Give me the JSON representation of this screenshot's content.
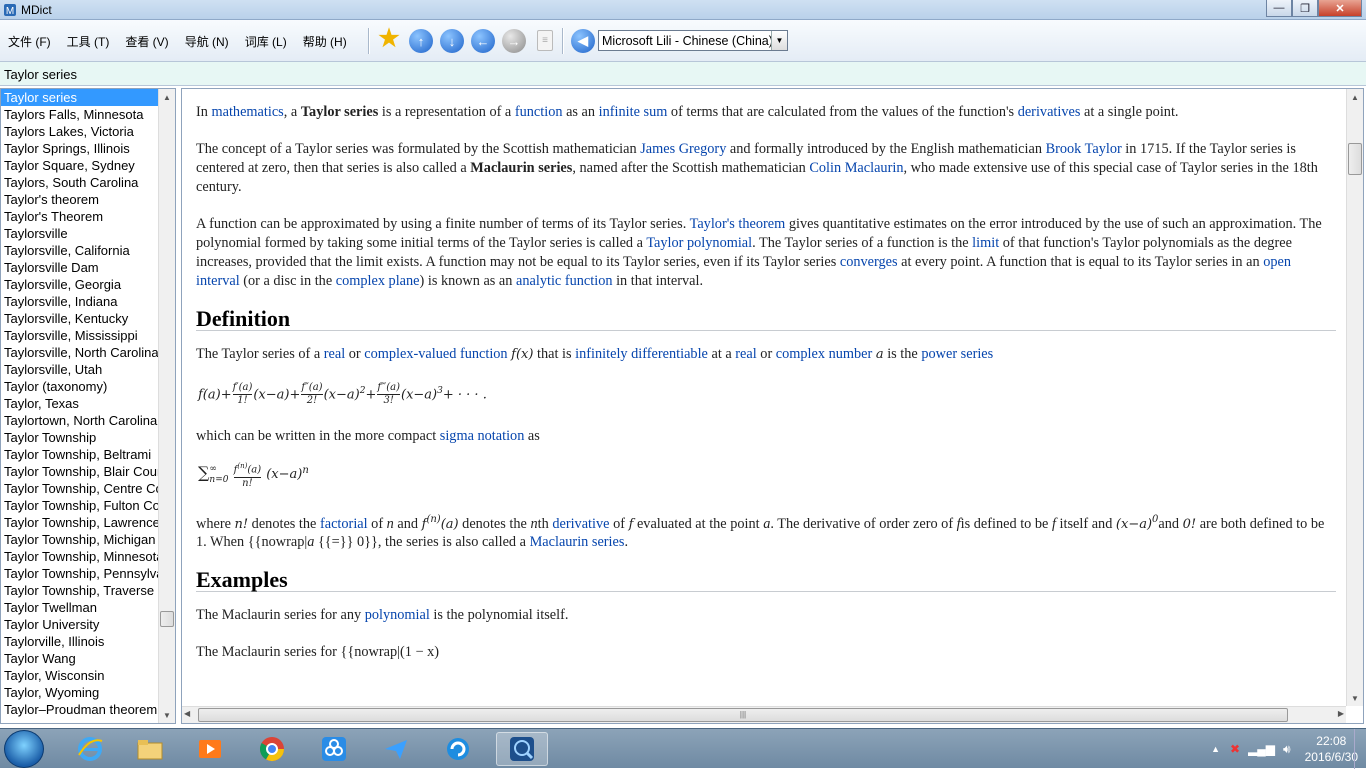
{
  "window": {
    "title": "MDict",
    "minimize": "—",
    "maximize": "❐",
    "close": "✕"
  },
  "menu": [
    "文件 (F)",
    "工具 (T)",
    "查看 (V)",
    "导航 (N)",
    "词库 (L)",
    "帮助 (H)"
  ],
  "toolbar": {
    "icons": [
      "star-icon",
      "arrow-up-icon",
      "arrow-down-icon",
      "back-icon",
      "forward-icon",
      "document-icon",
      "speak-icon"
    ],
    "voice_selected": "Microsoft Lili - Chinese (China)"
  },
  "search": {
    "value": "Taylor series"
  },
  "wordlist": [
    "Taylor series",
    "Taylors Falls, Minnesota",
    "Taylors Lakes, Victoria",
    "Taylor Springs, Illinois",
    "Taylor Square, Sydney",
    "Taylors, South Carolina",
    "Taylor's theorem",
    "Taylor's Theorem",
    "Taylorsville",
    "Taylorsville, California",
    "Taylorsville Dam",
    "Taylorsville, Georgia",
    "Taylorsville, Indiana",
    "Taylorsville, Kentucky",
    "Taylorsville, Mississippi",
    "Taylorsville, North Carolina",
    "Taylorsville, Utah",
    "Taylor (taxonomy)",
    "Taylor, Texas",
    "Taylortown, North Carolina",
    "Taylor Township",
    "Taylor Township, Beltrami",
    "Taylor Township, Blair County",
    "Taylor Township, Centre County",
    "Taylor Township, Fulton County",
    "Taylor Township, Lawrence",
    "Taylor Township, Michigan",
    "Taylor Township, Minnesota",
    "Taylor Township, Pennsylvania",
    "Taylor Township, Traverse",
    "Taylor Twellman",
    "Taylor University",
    "Taylorville, Illinois",
    "Taylor Wang",
    "Taylor, Wisconsin",
    "Taylor, Wyoming",
    "Taylor–Proudman theorem"
  ],
  "article": {
    "p1": {
      "t1": "In ",
      "l1": "mathematics",
      "t2": ", a ",
      "b1": "Taylor series",
      "t3": " is a representation of a ",
      "l2": "function",
      "t4": " as an ",
      "l3": "infinite sum",
      "t5": " of terms that are calculated from the values of the function's ",
      "l4": "derivatives",
      "t6": " at a single point."
    },
    "p2": {
      "t1": "The concept of a Taylor series was formulated by the Scottish mathematician ",
      "l1": "James Gregory",
      "t2": " and formally introduced by the English mathematician ",
      "l2": "Brook Taylor",
      "t3": " in 1715. If the Taylor series is centered at zero, then that series is also called a ",
      "b1": "Maclaurin series",
      "t4": ", named after the Scottish mathematician ",
      "l3": "Colin Maclaurin",
      "t5": ", who made extensive use of this special case of Taylor series in the 18th century."
    },
    "p3": {
      "t1": "A function can be approximated by using a finite number of terms of its Taylor series. ",
      "l1": "Taylor's theorem",
      "t2": " gives quantitative estimates on the error introduced by the use of such an approximation. The polynomial formed by taking some initial terms of the Taylor series is called a ",
      "l2": "Taylor polynomial",
      "t3": ". The Taylor series of a function is the ",
      "l3": "limit",
      "t4": " of that function's Taylor polynomials as the degree increases, provided that the limit exists. A function may not be equal to its Taylor series, even if its Taylor series ",
      "l4": "converges",
      "t5": " at every point. A function that is equal to its Taylor series in an ",
      "l5": "open interval",
      "t6": " (or a disc in the ",
      "l6": "complex plane",
      "t7": ") is known as an ",
      "l7": "analytic function",
      "t8": " in that interval."
    },
    "h_definition": "Definition",
    "p4": {
      "t1": "The Taylor series of a ",
      "l1": "real",
      "t2": " or ",
      "l2": "complex-valued function",
      "m1": "f(x)",
      "t3": " that is ",
      "l3": "infinitely differentiable",
      "t4": " at a ",
      "l4": "real",
      "t5": " or ",
      "l5": "complex number",
      "m2": "a",
      "t6": " is the ",
      "l6": "power series"
    },
    "p5": {
      "t1": "which can be written in the more compact ",
      "l1": "sigma notation",
      "t2": " as"
    },
    "p6": {
      "t1": "where ",
      "m1": "n!",
      "t2": " denotes the ",
      "l1": "factorial",
      "t3": " of ",
      "m2": "n",
      "t4": " and ",
      "m3": "f",
      "m3sup": "(n)",
      "m3b": "(a)",
      "t5": " denotes the ",
      "m4": "n",
      "t5b": "th ",
      "l2": "derivative",
      "t6": " of ",
      "m5": "f",
      "t7": " evaluated at the point ",
      "m6": "a",
      "t8": ". The derivative of order zero of ",
      "m7": "f",
      "t9": "is defined to be ",
      "m8": "f",
      "t10": " itself and ",
      "m9": "(x−a)",
      "m9sup": "0",
      "t11": "and ",
      "m10": "0!",
      "t12": " are both defined to be 1. When {{nowrap|",
      "m11": "a",
      "t13": " {{=}} 0}}, the series is also called a ",
      "l3": "Maclaurin series",
      "t14": "."
    },
    "h_examples": "Examples",
    "p7": {
      "t1": "The Maclaurin series for any ",
      "l1": "polynomial",
      "t2": " is the polynomial itself."
    },
    "p8_partial": "The Maclaurin series for {{nowrap|(1 − x)"
  },
  "taskbar": {
    "apps": [
      "ie-icon",
      "explorer-icon",
      "media-player-icon",
      "chrome-icon",
      "qq-icon",
      "feishu-icon",
      "browser-icon",
      "mdict-icon"
    ],
    "time": "22:08",
    "date": "2016/6/30"
  }
}
